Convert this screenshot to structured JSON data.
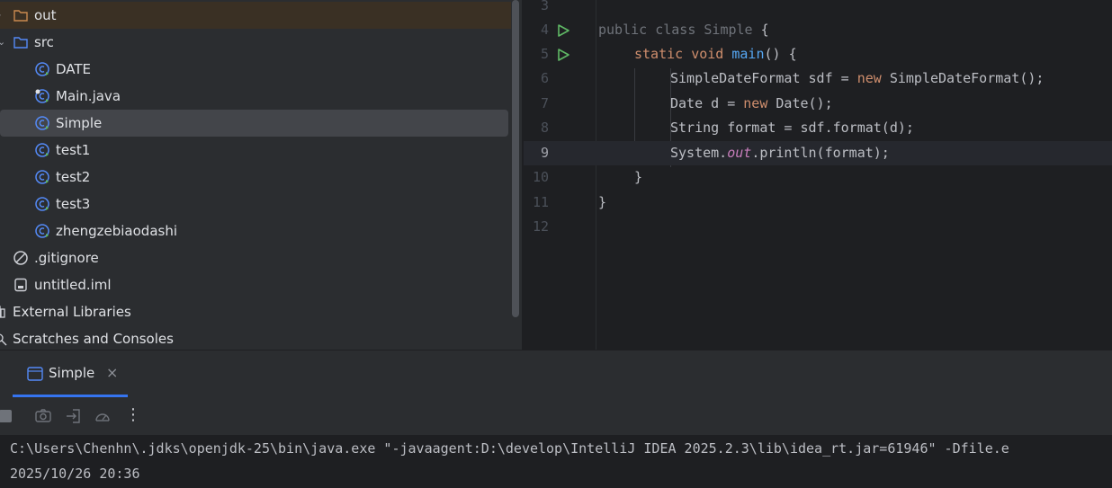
{
  "project_tree": {
    "items": [
      {
        "label": "out",
        "icon": "folder-icon",
        "line": "3"
      },
      {
        "label": "src",
        "icon": "source-folder-icon"
      },
      {
        "label": "DATE",
        "icon": "java-class-icon"
      },
      {
        "label": "Main.java",
        "icon": "java-file-icon"
      },
      {
        "label": "Simple",
        "icon": "java-class-icon"
      },
      {
        "label": "test1",
        "icon": "java-class-icon"
      },
      {
        "label": "test2",
        "icon": "java-class-icon"
      },
      {
        "label": "test3",
        "icon": "java-class-icon"
      },
      {
        "label": "zhengzebiaodashi",
        "icon": "java-class-icon"
      },
      {
        "label": ".gitignore",
        "icon": "ignore-file-icon"
      },
      {
        "label": "untitled.iml",
        "icon": "module-file-icon"
      },
      {
        "label": "External Libraries",
        "icon": "library-icon"
      },
      {
        "label": "Scratches and Consoles",
        "icon": "scratches-icon"
      }
    ]
  },
  "editor": {
    "line_numbers": [
      "3",
      "4",
      "5",
      "6",
      "7",
      "8",
      "9",
      "10",
      "11",
      "12"
    ],
    "current_line": "9",
    "code": {
      "l4_kw1": "public",
      "l4_kw2": "class",
      "l4_name": "Simple",
      "l4_brace": "{",
      "l5_kw1": "static",
      "l5_kw2": "void",
      "l5_fn": "main",
      "l5_rest": "() {",
      "l6_a": "SimpleDateFormat sdf = ",
      "l6_new": "new",
      "l6_b": " SimpleDateFormat();",
      "l7_a": "Date d = ",
      "l7_new": "new",
      "l7_b": " Date();",
      "l8": "String format = sdf.format(d);",
      "l9_a": "System.",
      "l9_out": "out",
      "l9_b": ".println(format);",
      "l10": "}",
      "l11": "}"
    }
  },
  "run_panel": {
    "tab_label": "Simple",
    "tab_close": "×",
    "toolbar": {
      "more": "⋮"
    },
    "console_lines": [
      "C:\\Users\\Chenhn\\.jdks\\openjdk-25\\bin\\java.exe \"-javaagent:D:\\develop\\IntelliJ IDEA 2025.2.3\\lib\\idea_rt.jar=61946\" -Dfile.e",
      "2025/10/26 20:36"
    ]
  },
  "colors": {
    "accent": "#3574f0",
    "run_green": "#5fb865",
    "keyword": "#cf8e6d",
    "function": "#56a8f5",
    "static_field": "#c77dbb"
  }
}
